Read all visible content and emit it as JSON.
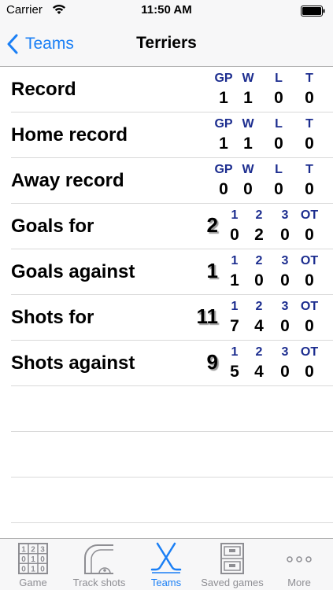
{
  "status_bar": {
    "carrier": "Carrier",
    "time": "11:50 AM"
  },
  "nav": {
    "back_label": "Teams",
    "title": "Terriers"
  },
  "rows": [
    {
      "label": "Record",
      "total": "",
      "headers": [
        "GP",
        "W",
        "L",
        "T"
      ],
      "values": [
        "1",
        "1",
        "0",
        "0"
      ]
    },
    {
      "label": "Home record",
      "total": "",
      "headers": [
        "GP",
        "W",
        "L",
        "T"
      ],
      "values": [
        "1",
        "1",
        "0",
        "0"
      ]
    },
    {
      "label": "Away record",
      "total": "",
      "headers": [
        "GP",
        "W",
        "L",
        "T"
      ],
      "values": [
        "0",
        "0",
        "0",
        "0"
      ]
    },
    {
      "label": "Goals for",
      "total": "2",
      "headers": [
        "1",
        "2",
        "3",
        "OT"
      ],
      "values": [
        "0",
        "2",
        "0",
        "0"
      ]
    },
    {
      "label": "Goals against",
      "total": "1",
      "headers": [
        "1",
        "2",
        "3",
        "OT"
      ],
      "values": [
        "1",
        "0",
        "0",
        "0"
      ]
    },
    {
      "label": "Shots for",
      "total": "11",
      "headers": [
        "1",
        "2",
        "3",
        "OT"
      ],
      "values": [
        "7",
        "4",
        "0",
        "0"
      ]
    },
    {
      "label": "Shots against",
      "total": "9",
      "headers": [
        "1",
        "2",
        "3",
        "OT"
      ],
      "values": [
        "5",
        "4",
        "0",
        "0"
      ]
    }
  ],
  "tabs": [
    {
      "label": "Game",
      "icon": "scoreboard-grid-icon",
      "active": false
    },
    {
      "label": "Track shots",
      "icon": "rink-icon",
      "active": false
    },
    {
      "label": "Teams",
      "icon": "hockey-sticks-icon",
      "active": true
    },
    {
      "label": "Saved games",
      "icon": "file-cabinet-icon",
      "active": false
    },
    {
      "label": "More",
      "icon": "more-dots-icon",
      "active": false
    }
  ],
  "colors": {
    "accent": "#1a7ff5",
    "column_header": "#1c2d8f",
    "tab_inactive": "#8e8e93"
  },
  "scoreboard_icon_digits": [
    "1",
    "2",
    "3",
    "0",
    "1",
    "0",
    "0",
    "1",
    "0"
  ]
}
